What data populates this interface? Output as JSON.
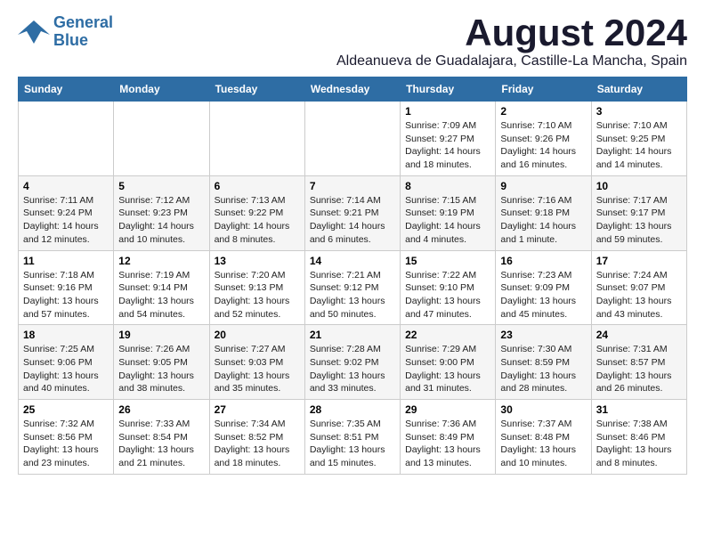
{
  "header": {
    "logo_line1": "General",
    "logo_line2": "Blue",
    "month_year": "August 2024",
    "location": "Aldeanueva de Guadalajara, Castille-La Mancha, Spain"
  },
  "weekdays": [
    "Sunday",
    "Monday",
    "Tuesday",
    "Wednesday",
    "Thursday",
    "Friday",
    "Saturday"
  ],
  "weeks": [
    [
      {
        "day": "",
        "info": ""
      },
      {
        "day": "",
        "info": ""
      },
      {
        "day": "",
        "info": ""
      },
      {
        "day": "",
        "info": ""
      },
      {
        "day": "1",
        "info": "Sunrise: 7:09 AM\nSunset: 9:27 PM\nDaylight: 14 hours\nand 18 minutes."
      },
      {
        "day": "2",
        "info": "Sunrise: 7:10 AM\nSunset: 9:26 PM\nDaylight: 14 hours\nand 16 minutes."
      },
      {
        "day": "3",
        "info": "Sunrise: 7:10 AM\nSunset: 9:25 PM\nDaylight: 14 hours\nand 14 minutes."
      }
    ],
    [
      {
        "day": "4",
        "info": "Sunrise: 7:11 AM\nSunset: 9:24 PM\nDaylight: 14 hours\nand 12 minutes."
      },
      {
        "day": "5",
        "info": "Sunrise: 7:12 AM\nSunset: 9:23 PM\nDaylight: 14 hours\nand 10 minutes."
      },
      {
        "day": "6",
        "info": "Sunrise: 7:13 AM\nSunset: 9:22 PM\nDaylight: 14 hours\nand 8 minutes."
      },
      {
        "day": "7",
        "info": "Sunrise: 7:14 AM\nSunset: 9:21 PM\nDaylight: 14 hours\nand 6 minutes."
      },
      {
        "day": "8",
        "info": "Sunrise: 7:15 AM\nSunset: 9:19 PM\nDaylight: 14 hours\nand 4 minutes."
      },
      {
        "day": "9",
        "info": "Sunrise: 7:16 AM\nSunset: 9:18 PM\nDaylight: 14 hours\nand 1 minute."
      },
      {
        "day": "10",
        "info": "Sunrise: 7:17 AM\nSunset: 9:17 PM\nDaylight: 13 hours\nand 59 minutes."
      }
    ],
    [
      {
        "day": "11",
        "info": "Sunrise: 7:18 AM\nSunset: 9:16 PM\nDaylight: 13 hours\nand 57 minutes."
      },
      {
        "day": "12",
        "info": "Sunrise: 7:19 AM\nSunset: 9:14 PM\nDaylight: 13 hours\nand 54 minutes."
      },
      {
        "day": "13",
        "info": "Sunrise: 7:20 AM\nSunset: 9:13 PM\nDaylight: 13 hours\nand 52 minutes."
      },
      {
        "day": "14",
        "info": "Sunrise: 7:21 AM\nSunset: 9:12 PM\nDaylight: 13 hours\nand 50 minutes."
      },
      {
        "day": "15",
        "info": "Sunrise: 7:22 AM\nSunset: 9:10 PM\nDaylight: 13 hours\nand 47 minutes."
      },
      {
        "day": "16",
        "info": "Sunrise: 7:23 AM\nSunset: 9:09 PM\nDaylight: 13 hours\nand 45 minutes."
      },
      {
        "day": "17",
        "info": "Sunrise: 7:24 AM\nSunset: 9:07 PM\nDaylight: 13 hours\nand 43 minutes."
      }
    ],
    [
      {
        "day": "18",
        "info": "Sunrise: 7:25 AM\nSunset: 9:06 PM\nDaylight: 13 hours\nand 40 minutes."
      },
      {
        "day": "19",
        "info": "Sunrise: 7:26 AM\nSunset: 9:05 PM\nDaylight: 13 hours\nand 38 minutes."
      },
      {
        "day": "20",
        "info": "Sunrise: 7:27 AM\nSunset: 9:03 PM\nDaylight: 13 hours\nand 35 minutes."
      },
      {
        "day": "21",
        "info": "Sunrise: 7:28 AM\nSunset: 9:02 PM\nDaylight: 13 hours\nand 33 minutes."
      },
      {
        "day": "22",
        "info": "Sunrise: 7:29 AM\nSunset: 9:00 PM\nDaylight: 13 hours\nand 31 minutes."
      },
      {
        "day": "23",
        "info": "Sunrise: 7:30 AM\nSunset: 8:59 PM\nDaylight: 13 hours\nand 28 minutes."
      },
      {
        "day": "24",
        "info": "Sunrise: 7:31 AM\nSunset: 8:57 PM\nDaylight: 13 hours\nand 26 minutes."
      }
    ],
    [
      {
        "day": "25",
        "info": "Sunrise: 7:32 AM\nSunset: 8:56 PM\nDaylight: 13 hours\nand 23 minutes."
      },
      {
        "day": "26",
        "info": "Sunrise: 7:33 AM\nSunset: 8:54 PM\nDaylight: 13 hours\nand 21 minutes."
      },
      {
        "day": "27",
        "info": "Sunrise: 7:34 AM\nSunset: 8:52 PM\nDaylight: 13 hours\nand 18 minutes."
      },
      {
        "day": "28",
        "info": "Sunrise: 7:35 AM\nSunset: 8:51 PM\nDaylight: 13 hours\nand 15 minutes."
      },
      {
        "day": "29",
        "info": "Sunrise: 7:36 AM\nSunset: 8:49 PM\nDaylight: 13 hours\nand 13 minutes."
      },
      {
        "day": "30",
        "info": "Sunrise: 7:37 AM\nSunset: 8:48 PM\nDaylight: 13 hours\nand 10 minutes."
      },
      {
        "day": "31",
        "info": "Sunrise: 7:38 AM\nSunset: 8:46 PM\nDaylight: 13 hours\nand 8 minutes."
      }
    ]
  ]
}
